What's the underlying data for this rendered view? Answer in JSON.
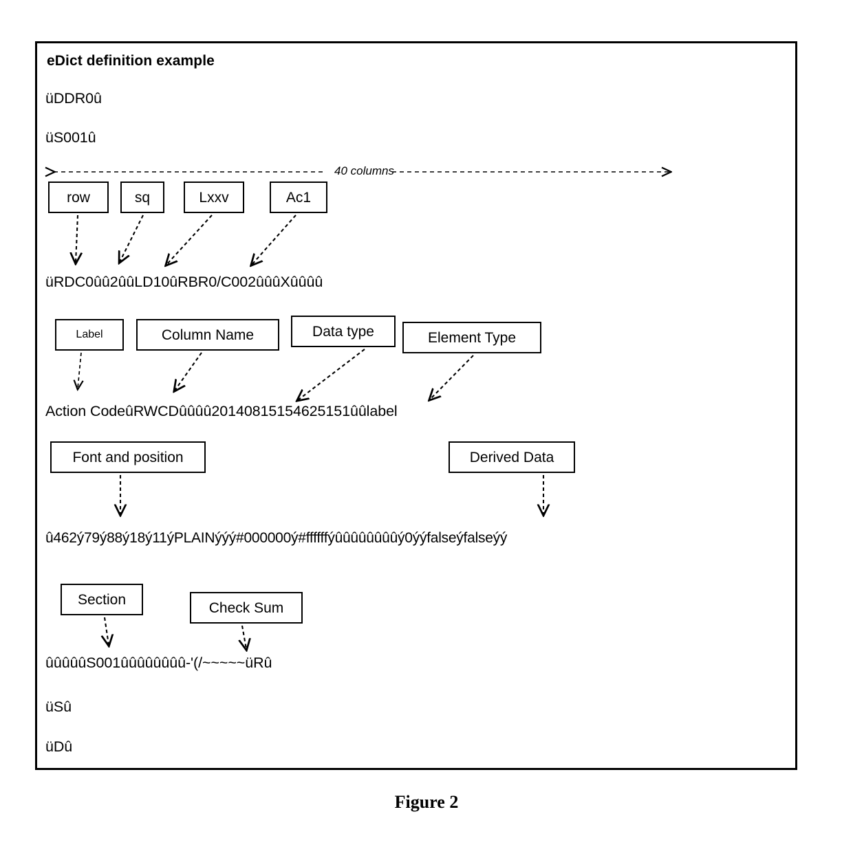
{
  "figure": {
    "caption": "Figure 2",
    "title": "eDict definition example"
  },
  "lines": {
    "header1": "üDDR0û",
    "header2": "üS001û",
    "record": "üRDC0ûû2ûûLD10ûRBR0/C002ûûûXûûûû",
    "action": "Action CodeûRWCDûûûû20140815154625151ûûlabel",
    "font_position": "û462ý79ý88ý18ý11ýPLAINýýý#000000ý#ffffffýûûûûûûûûý0ýýfalseýfalseýý",
    "section_line": "ûûûûûS001ûûûûûûûû-'(/~~~~~üRû",
    "footer1": "üSû",
    "footer2": "üDû"
  },
  "span": {
    "label": "40 columns"
  },
  "callouts": {
    "row1": [
      {
        "label": "row"
      },
      {
        "label": "sq"
      },
      {
        "label": "Lxxv"
      },
      {
        "label": "Ac1"
      }
    ],
    "row2": [
      {
        "label": "Label"
      },
      {
        "label": "Column Name"
      },
      {
        "label": "Data type"
      },
      {
        "label": "Element Type"
      }
    ],
    "row3": [
      {
        "label": "Font and position"
      },
      {
        "label": "Derived Data"
      }
    ],
    "row4": [
      {
        "label": "Section"
      },
      {
        "label": "Check Sum"
      }
    ]
  },
  "colors": {
    "ink": "#000000",
    "paper": "#ffffff"
  }
}
